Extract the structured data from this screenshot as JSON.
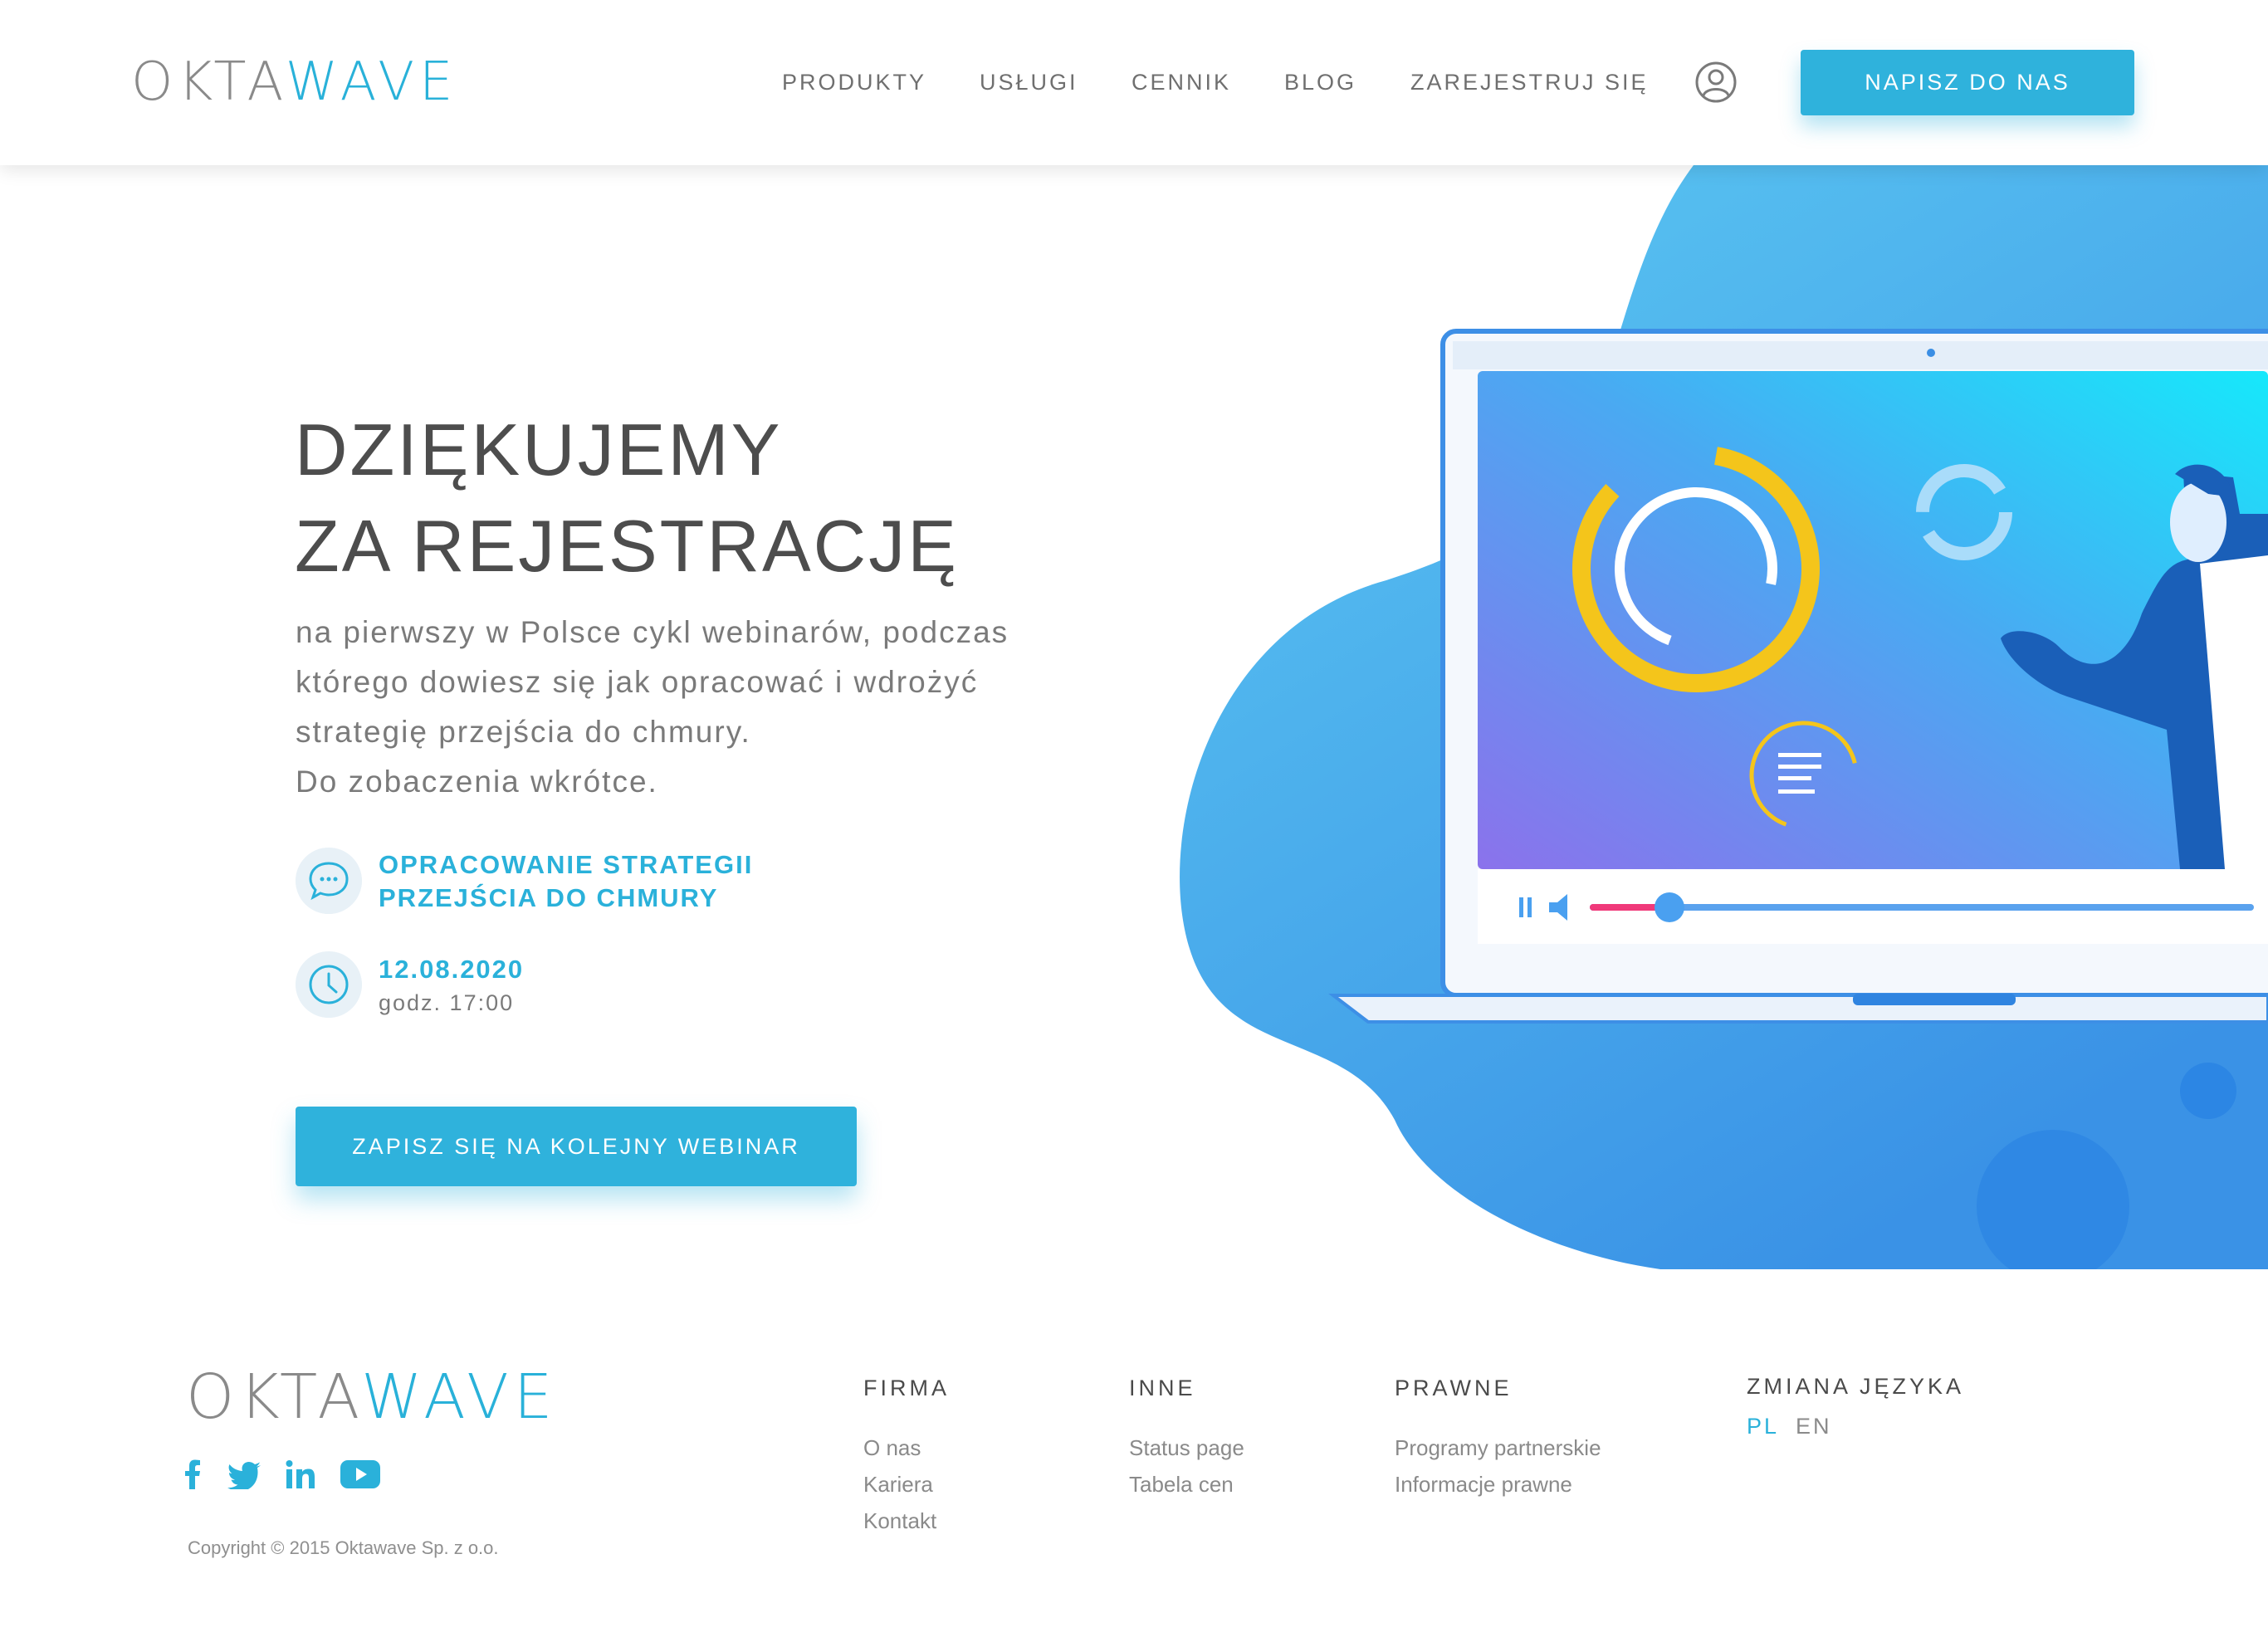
{
  "header": {
    "logo_part1": "OKTA",
    "logo_part2": "WAVE",
    "nav": [
      "PRODUKTY",
      "USŁUGI",
      "CENNIK",
      "BLOG",
      "ZAREJESTRUJ SIĘ"
    ],
    "user_icon": "user-icon",
    "cta": "NAPISZ DO NAS"
  },
  "hero": {
    "title_line1": "DZIĘKUJEMY",
    "title_line2": "ZA REJESTRACJĘ",
    "desc_lines": [
      "na pierwszy w Polsce cykl webinarów, podczas",
      "którego dowiesz się jak opracować i wdrożyć",
      "strategię przejścia do chmury.",
      "Do zobaczenia wkrótce."
    ],
    "topic_icon": "chat-icon",
    "topic_line1": "OPRACOWANIE STRATEGII",
    "topic_line2": "PRZEJŚCIA DO CHMURY",
    "date_icon": "clock-icon",
    "date": "12.08.2020",
    "time": "godz. 17:00",
    "cta": "ZAPISZ SIĘ NA KOLEJNY WEBINAR"
  },
  "video_player": {
    "progress": 0.12
  },
  "footer": {
    "logo_part1": "OKTA",
    "logo_part2": "WAVE",
    "social": [
      "facebook-icon",
      "twitter-icon",
      "linkedin-icon",
      "youtube-icon"
    ],
    "columns": [
      {
        "heading": "FIRMA",
        "links": [
          "O nas",
          "Kariera",
          "Kontakt"
        ]
      },
      {
        "heading": "INNE",
        "links": [
          "Status page",
          "Tabela cen"
        ]
      },
      {
        "heading": "PRAWNE",
        "links": [
          "Programy partnerskie",
          "Informacje prawne"
        ]
      }
    ],
    "language": {
      "heading": "ZMIANA JĘZYKA",
      "options": [
        "PL",
        "EN"
      ],
      "active": "PL"
    },
    "copyright": "Copyright © 2015 Oktawave Sp. z o.o."
  },
  "colors": {
    "accent": "#2fb2dc",
    "heading": "#4d4d4d",
    "text": "#7a7a7a",
    "progress_played": "#f0397a",
    "ring_yellow": "#f4c51b"
  }
}
